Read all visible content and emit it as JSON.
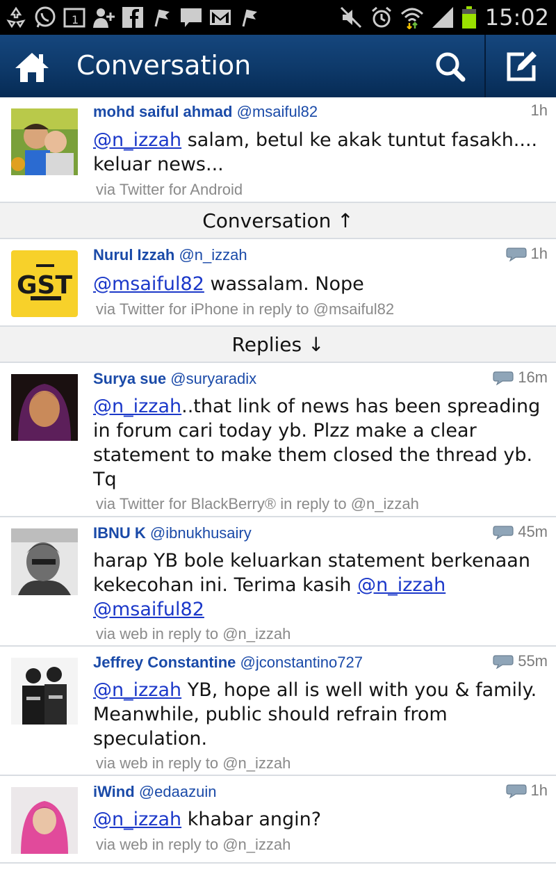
{
  "status_bar": {
    "time": "15:02",
    "left_icons": [
      "recycle-icon",
      "whatsapp-icon",
      "calendar-icon",
      "add-contact-icon",
      "facebook-icon",
      "flag-icon",
      "message-icon",
      "gmail-icon",
      "flag-icon"
    ],
    "right_icons": [
      "mute-icon",
      "alarm-icon",
      "wifi-icon",
      "signal-icon",
      "battery-icon"
    ]
  },
  "action_bar": {
    "title": "Conversation",
    "home_icon": "home-icon",
    "search_icon": "search-icon",
    "compose_icon": "compose-icon",
    "color": "#0e3a6b"
  },
  "tweets": [
    {
      "name": "mohd saiful ahmad",
      "handle": "@msaiful82",
      "time": "1h",
      "has_reply_icon": false,
      "mention": "@n_izzah",
      "text": "salam, betul ke akak tuntut fasakh.... keluar news...",
      "via": "via Twitter for Android"
    },
    {
      "name": "Nurul Izzah",
      "handle": "@n_izzah",
      "time": "1h",
      "has_reply_icon": true,
      "mention": "@msaiful82",
      "text": "wassalam. Nope",
      "via": "via Twitter for iPhone in reply to @msaiful82"
    },
    {
      "name": "Surya sue",
      "handle": "@suryaradix",
      "time": "16m",
      "has_reply_icon": true,
      "mention": "@n_izzah",
      "text": "..that link of news has been spreading in forum cari today yb. Plzz make a clear statement to make them closed the thread yb. Tq",
      "via": "via Twitter for BlackBerry® in reply to @n_izzah"
    },
    {
      "name": "IBNU K",
      "handle": "@ibnukhusairy",
      "time": "45m",
      "has_reply_icon": true,
      "text_before": "harap YB bole keluarkan statement berkenaan kekecohan ini. Terima kasih",
      "mention": "@n_izzah",
      "mention2": "@msaiful82",
      "via": "via web in reply to @n_izzah"
    },
    {
      "name": "Jeffrey Constantine",
      "handle": "@jconstantino727",
      "time": "55m",
      "has_reply_icon": true,
      "mention": "@n_izzah",
      "text": "YB, hope all is well with you & family. Meanwhile, public should refrain from speculation.",
      "via": "via web in reply to @n_izzah"
    },
    {
      "name": "iWind",
      "handle": "@edaazuin",
      "time": "1h",
      "has_reply_icon": true,
      "mention": "@n_izzah",
      "text": "khabar angin?",
      "via": "via web in reply to @n_izzah"
    }
  ],
  "sections": {
    "conversation": "Conversation ↑",
    "replies": "Replies ↓"
  },
  "colors": {
    "link": "#1b38c9",
    "author": "#1a4aa8",
    "meta": "#8a8a8a"
  }
}
